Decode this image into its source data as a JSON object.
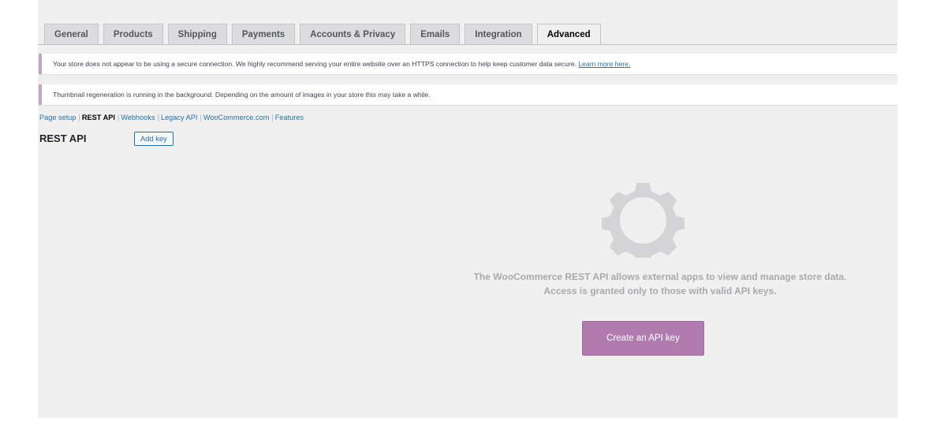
{
  "tabs": [
    "General",
    "Products",
    "Shipping",
    "Payments",
    "Accounts & Privacy",
    "Emails",
    "Integration",
    "Advanced"
  ],
  "active_tab": "Advanced",
  "notices": {
    "https_text": "Your store does not appear to be using a secure connection. We highly recommend serving your entire website over an HTTPS connection to help keep customer data secure.",
    "https_link": "Learn more here.",
    "thumbnail_text": "Thumbnail regeneration is running in the background. Depending on the amount of images in your store this may take a while."
  },
  "subnav": [
    "Page setup",
    "REST API",
    "Webhooks",
    "Legacy API",
    "WooCommerce.com",
    "Features"
  ],
  "subnav_separator": "|",
  "subnav_current": "REST API",
  "section": {
    "title": "REST API",
    "add_key_label": "Add key"
  },
  "empty_state": {
    "icon": "gear-icon",
    "text": "The WooCommerce REST API allows external apps to view and manage store data. Access is granted only to those with valid API keys.",
    "button_label": "Create an API key"
  },
  "colors": {
    "accent": "#b07cae",
    "notice_border": "#c3a3c1",
    "link": "#2271b1",
    "background": "#f0f0f1"
  }
}
